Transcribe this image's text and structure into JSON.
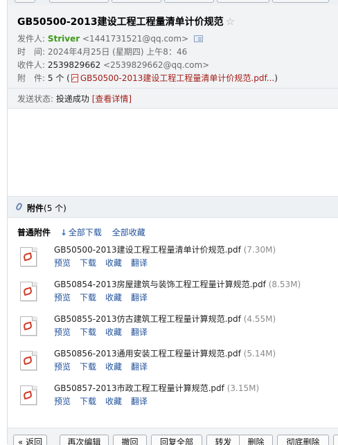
{
  "mail": {
    "subject": "GB50500-2013建设工程工程量清单计价规范",
    "star_icon": "☆",
    "from_label": "发件人:",
    "from_name": "Striver",
    "from_email": "<1441731521@qq.com>",
    "time_label": "时　间:",
    "time_value": "2024年4月25日 (星期四) 上午8：46",
    "to_label": "收件人:",
    "to_name": "2539829662",
    "to_email": "<2539829662@qq.com>",
    "att_label": "附　件:",
    "att_count": "5 个 (",
    "att_first": "GB50500-2013建设工程工程量清单计价规范.pdf...",
    "att_close": ")",
    "status_label": "发送状态:",
    "status_value": "投递成功",
    "status_link": "[查看详情]"
  },
  "attachments": {
    "title": "附件",
    "count": "(5 个)",
    "section_label": "普通附件",
    "download_all": "全部下载",
    "save_all": "全部收藏",
    "action_labels": {
      "preview": "预览",
      "download": "下载",
      "save": "收藏",
      "translate": "翻译"
    },
    "files": [
      {
        "name": "GB50500-2013建设工程工程量清单计价规范.pdf",
        "size": "(7.30M)"
      },
      {
        "name": "GB50854-2013房屋建筑与装饰工程工程量计算规范.pdf",
        "size": "(8.53M)"
      },
      {
        "name": "GB50855-2013仿古建筑工程工程量计算规范.pdf",
        "size": "(4.55M)"
      },
      {
        "name": "GB50856-2013通用安装工程工程量计算规范.pdf",
        "size": "(5.14M)"
      },
      {
        "name": "GB50857-2013市政工程工程量计算规范.pdf",
        "size": "(3.15M)"
      }
    ]
  },
  "toolbar": {
    "back": "« 返回",
    "edit_again": "再次编辑",
    "recall": "撤回",
    "reply_all": "回复全部",
    "forward": "转发",
    "delete": "删除",
    "delete_permanently": "彻底删除"
  }
}
